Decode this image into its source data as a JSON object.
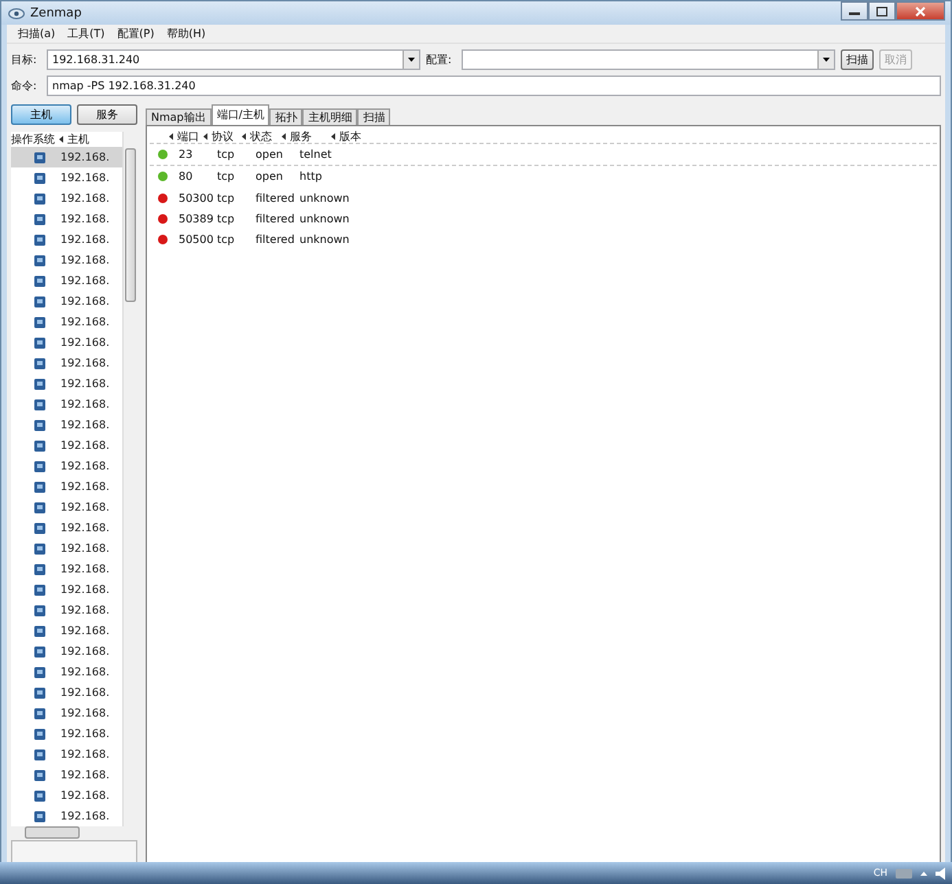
{
  "window": {
    "title": "Zenmap"
  },
  "menu": [
    "扫描(a)",
    "工具(T)",
    "配置(P)",
    "帮助(H)"
  ],
  "target": {
    "label": "目标:",
    "value": "192.168.31.240"
  },
  "profile": {
    "label": "配置:"
  },
  "scan_button": {
    "label": "扫描",
    "disabled": false
  },
  "cancel_button": {
    "label": "取消",
    "disabled": true
  },
  "command": {
    "label": "命令:",
    "value": "nmap -PS 192.168.31.240"
  },
  "view_buttons": [
    {
      "label": "主机",
      "selected": true
    },
    {
      "label": "服务",
      "selected": false
    }
  ],
  "host_columns": [
    "操作系统",
    "主机"
  ],
  "hosts": [
    {
      "address": "192.168.",
      "selected": true
    },
    {
      "address": "192.168.",
      "selected": false
    },
    {
      "address": "192.168.",
      "selected": false
    },
    {
      "address": "192.168.",
      "selected": false
    },
    {
      "address": "192.168.",
      "selected": false
    },
    {
      "address": "192.168.",
      "selected": false
    },
    {
      "address": "192.168.",
      "selected": false
    },
    {
      "address": "192.168.",
      "selected": false
    },
    {
      "address": "192.168.",
      "selected": false
    },
    {
      "address": "192.168.",
      "selected": false
    },
    {
      "address": "192.168.",
      "selected": false
    },
    {
      "address": "192.168.",
      "selected": false
    },
    {
      "address": "192.168.",
      "selected": false
    },
    {
      "address": "192.168.",
      "selected": false
    },
    {
      "address": "192.168.",
      "selected": false
    },
    {
      "address": "192.168.",
      "selected": false
    },
    {
      "address": "192.168.",
      "selected": false
    },
    {
      "address": "192.168.",
      "selected": false
    },
    {
      "address": "192.168.",
      "selected": false
    },
    {
      "address": "192.168.",
      "selected": false
    },
    {
      "address": "192.168.",
      "selected": false
    },
    {
      "address": "192.168.",
      "selected": false
    },
    {
      "address": "192.168.",
      "selected": false
    },
    {
      "address": "192.168.",
      "selected": false
    },
    {
      "address": "192.168.",
      "selected": false
    },
    {
      "address": "192.168.",
      "selected": false
    },
    {
      "address": "192.168.",
      "selected": false
    },
    {
      "address": "192.168.",
      "selected": false
    },
    {
      "address": "192.168.",
      "selected": false
    },
    {
      "address": "192.168.",
      "selected": false
    },
    {
      "address": "192.168.",
      "selected": false
    },
    {
      "address": "192.168.",
      "selected": false
    },
    {
      "address": "192.168.",
      "selected": false
    }
  ],
  "tabs": [
    {
      "label": "Nmap输出",
      "selected": false
    },
    {
      "label": "端口/主机",
      "selected": true
    },
    {
      "label": "拓扑",
      "selected": false
    },
    {
      "label": "主机明细",
      "selected": false
    },
    {
      "label": "扫描",
      "selected": false
    }
  ],
  "port_columns": [
    "端口",
    "协议",
    "状态",
    "服务",
    "版本"
  ],
  "ports": [
    {
      "port": "23",
      "protocol": "tcp",
      "state": "open",
      "service": "telnet",
      "color": "#5cb82a"
    },
    {
      "port": "80",
      "protocol": "tcp",
      "state": "open",
      "service": "http",
      "color": "#5cb82a"
    },
    {
      "port": "50300",
      "protocol": "tcp",
      "state": "filtered",
      "service": "unknown",
      "color": "#d81818"
    },
    {
      "port": "50389",
      "protocol": "tcp",
      "state": "filtered",
      "service": "unknown",
      "color": "#d81818"
    },
    {
      "port": "50500",
      "protocol": "tcp",
      "state": "filtered",
      "service": "unknown",
      "color": "#d81818"
    }
  ],
  "taskbar": {
    "tray_text": "CH"
  }
}
